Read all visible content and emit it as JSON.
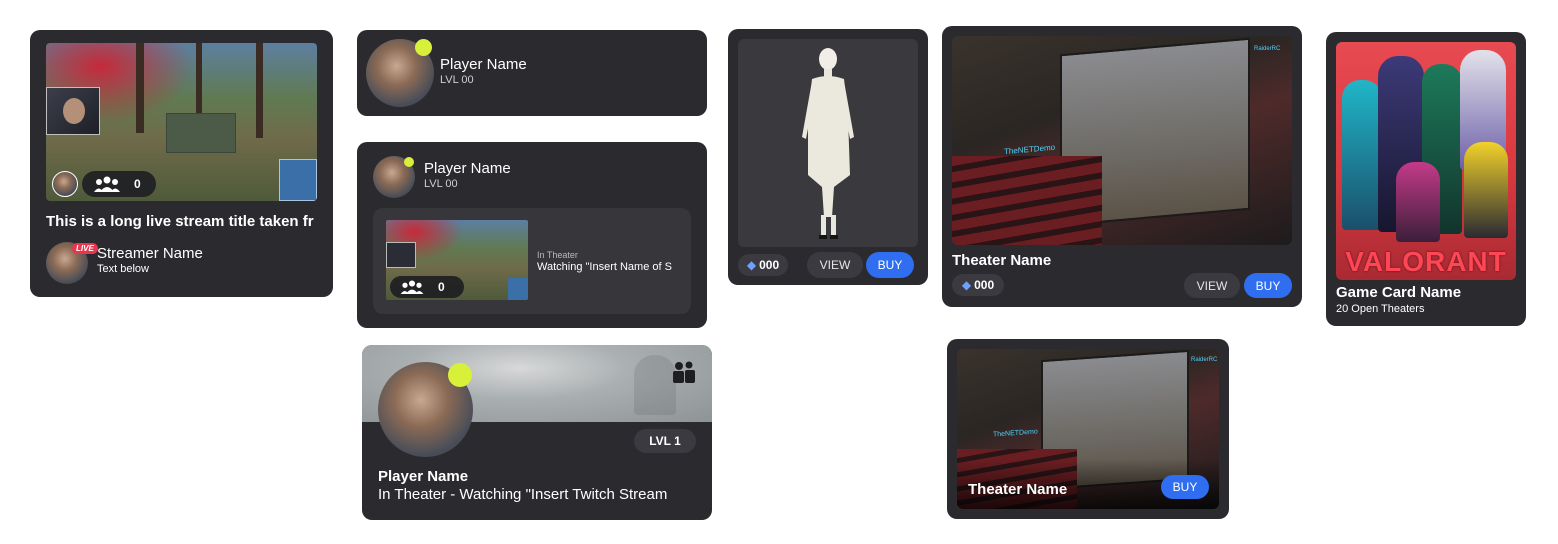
{
  "stream_card": {
    "title": "This is a long live stream title taken fr",
    "viewer_count": "0",
    "live_badge": "LIVE",
    "streamer_name": "Streamer Name",
    "subtext": "Text below"
  },
  "player_card_small": {
    "name": "Player Name",
    "level": "LVL 00"
  },
  "player_card_theater": {
    "name": "Player Name",
    "level": "LVL 00",
    "status_label": "In Theater",
    "watching_text": "Watching \"Insert Name of S",
    "viewer_count": "0"
  },
  "player_profile_card": {
    "name": "Player Name",
    "level": "LVL 1",
    "status": "In Theater - Watching \"Insert Twitch Stream"
  },
  "outfit_card": {
    "price": "000",
    "view_label": "VIEW",
    "buy_label": "BUY"
  },
  "theater_card_large": {
    "title": "Theater Name",
    "price": "000",
    "view_label": "VIEW",
    "buy_label": "BUY",
    "screen_overlay": "TheNETDemo",
    "chat_text": "RaiderRC"
  },
  "theater_card_small": {
    "title": "Theater Name",
    "buy_label": "BUY",
    "screen_overlay": "TheNETDemo",
    "chat_text": "RaiderRC"
  },
  "game_card": {
    "logo_text": "VALORANT",
    "name": "Game Card Name",
    "subtitle": "20 Open Theaters"
  },
  "colors": {
    "card_bg": "#2b2a2f",
    "buy_blue": "#2f6ef0",
    "online_dot": "#d8f03a",
    "live_red": "#e8364f",
    "valorant_red": "#ff4655"
  }
}
